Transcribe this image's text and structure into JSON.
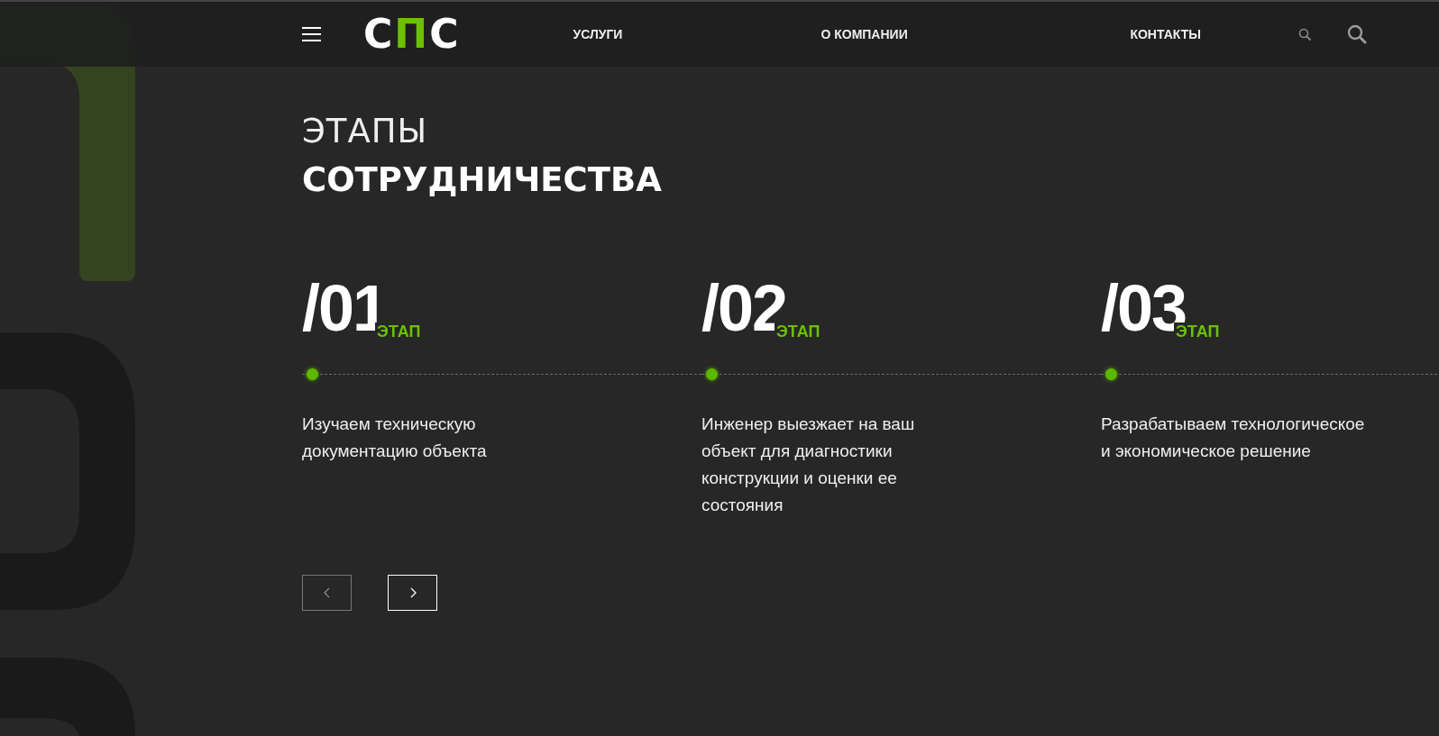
{
  "header": {
    "logo": [
      "С",
      "П",
      "С"
    ],
    "nav": [
      "УСЛУГИ",
      "О КОМПАНИИ",
      "КОНТАКТЫ"
    ]
  },
  "section": {
    "title_light": "ЭТАПЫ",
    "title_bold": "СОТРУДНИЧЕСТВА",
    "steps": [
      {
        "number": "/01",
        "label": "ЭТАП",
        "text": "Изучаем техническую документацию объекта"
      },
      {
        "number": "/02",
        "label": "ЭТАП",
        "text": "Инженер выезжает на ваш объект для диагностики конструкции и оценки ее состояния"
      },
      {
        "number": "/03",
        "label": "ЭТАП",
        "text": "Разрабатываем технологическое и экономическое решение"
      }
    ],
    "controls": [
      {
        "kind": "prev",
        "disabled": true
      },
      {
        "kind": "next",
        "disabled": false
      }
    ]
  }
}
